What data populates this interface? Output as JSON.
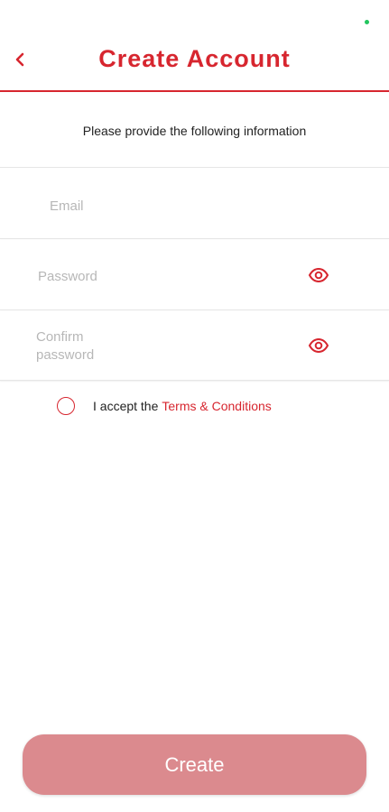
{
  "header": {
    "title": "Create Account",
    "back_icon": "chevron-left-icon"
  },
  "subtitle": "Please provide the following information",
  "form": {
    "email": {
      "placeholder": "Email",
      "value": ""
    },
    "password": {
      "placeholder": "Password",
      "value": "",
      "toggle_icon": "eye-icon"
    },
    "confirm_password": {
      "placeholder_line1": "Confirm",
      "placeholder_line2": "password",
      "value": "",
      "toggle_icon": "eye-icon"
    }
  },
  "terms": {
    "prefix": "I accept the",
    "link": "Terms & Conditions",
    "checked": false
  },
  "create_button": {
    "label": "Create"
  },
  "colors": {
    "accent": "#d7262f",
    "button_disabled": "#db8a8e",
    "placeholder": "#b7b7b7",
    "status_dot": "#22c55e"
  }
}
